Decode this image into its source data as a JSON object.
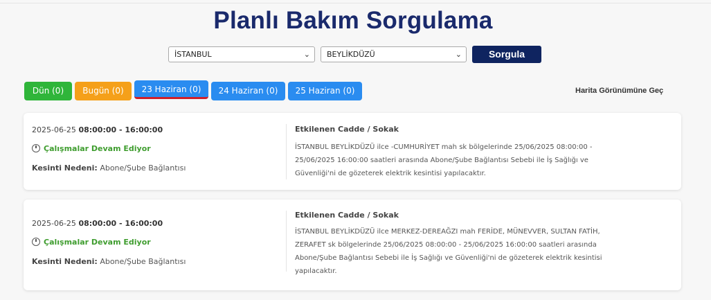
{
  "page": {
    "title": "Planlı Bakım Sorgulama"
  },
  "filters": {
    "city": "İSTANBUL",
    "district": "BEYLİKDÜZÜ",
    "submit_label": "Sorgula"
  },
  "tabs": [
    {
      "label": "Dün (0)",
      "color": "#2fb53a"
    },
    {
      "label": "Bugün (0)",
      "color": "#f5a01a"
    },
    {
      "label": "23 Haziran (0)",
      "color": "#2a8cf0",
      "active": true
    },
    {
      "label": "24 Haziran (0)",
      "color": "#2a8cf0"
    },
    {
      "label": "25 Haziran (0)",
      "color": "#2a8cf0"
    }
  ],
  "map_link": "Harita Görünümüne Geç",
  "records": [
    {
      "date": "2025-06-25",
      "time": "08:00:00 - 16:00:00",
      "status": "Çalışmalar Devam Ediyor",
      "reason_label": "Kesinti Nedeni:",
      "reason": "Abone/Şube Bağlantısı",
      "affected_title": "Etkilenen Cadde / Sokak",
      "affected_text": "İSTANBUL BEYLİKDÜZÜ ilce -CUMHURİYET mah sk bölgelerinde 25/06/2025 08:00:00 - 25/06/2025 16:00:00 saatleri arasında Abone/Şube Bağlantısı Sebebi ile İş Sağlığı ve Güvenliği'ni de gözeterek elektrik kesintisi yapılacaktır."
    },
    {
      "date": "2025-06-25",
      "time": "08:00:00 - 16:00:00",
      "status": "Çalışmalar Devam Ediyor",
      "reason_label": "Kesinti Nedeni:",
      "reason": "Abone/Şube Bağlantısı",
      "affected_title": "Etkilenen Cadde / Sokak",
      "affected_text": "İSTANBUL BEYLİKDÜZÜ ilce MERKEZ-DEREAĞZI mah FERİDE, MÜNEVVER, SULTAN FATİH, ZERAFET sk bölgelerinde 25/06/2025 08:00:00 - 25/06/2025 16:00:00 saatleri arasında Abone/Şube Bağlantısı Sebebi ile İş Sağlığı ve Güvenliği'ni de gözeterek elektrik kesintisi yapılacaktır."
    }
  ]
}
